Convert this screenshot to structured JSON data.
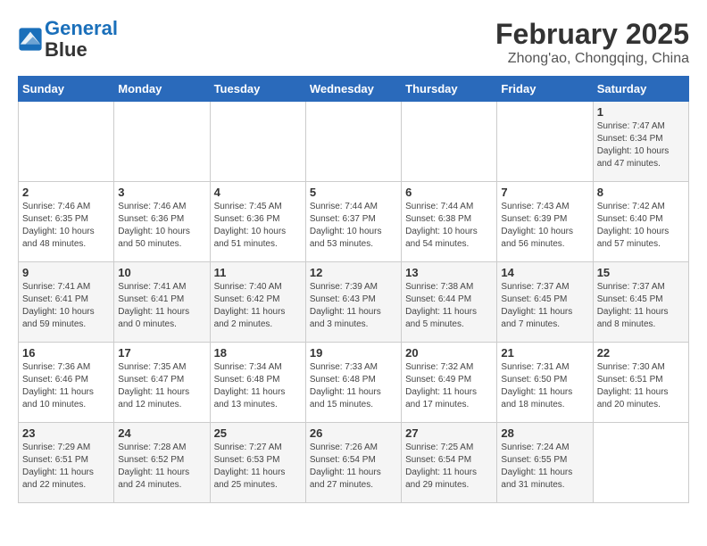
{
  "header": {
    "logo_line1": "General",
    "logo_line2": "Blue",
    "month_title": "February 2025",
    "location": "Zhong'ao, Chongqing, China"
  },
  "weekdays": [
    "Sunday",
    "Monday",
    "Tuesday",
    "Wednesday",
    "Thursday",
    "Friday",
    "Saturday"
  ],
  "weeks": [
    [
      {
        "day": "",
        "info": ""
      },
      {
        "day": "",
        "info": ""
      },
      {
        "day": "",
        "info": ""
      },
      {
        "day": "",
        "info": ""
      },
      {
        "day": "",
        "info": ""
      },
      {
        "day": "",
        "info": ""
      },
      {
        "day": "1",
        "info": "Sunrise: 7:47 AM\nSunset: 6:34 PM\nDaylight: 10 hours and 47 minutes."
      }
    ],
    [
      {
        "day": "2",
        "info": "Sunrise: 7:46 AM\nSunset: 6:35 PM\nDaylight: 10 hours and 48 minutes."
      },
      {
        "day": "3",
        "info": "Sunrise: 7:46 AM\nSunset: 6:36 PM\nDaylight: 10 hours and 50 minutes."
      },
      {
        "day": "4",
        "info": "Sunrise: 7:45 AM\nSunset: 6:36 PM\nDaylight: 10 hours and 51 minutes."
      },
      {
        "day": "5",
        "info": "Sunrise: 7:44 AM\nSunset: 6:37 PM\nDaylight: 10 hours and 53 minutes."
      },
      {
        "day": "6",
        "info": "Sunrise: 7:44 AM\nSunset: 6:38 PM\nDaylight: 10 hours and 54 minutes."
      },
      {
        "day": "7",
        "info": "Sunrise: 7:43 AM\nSunset: 6:39 PM\nDaylight: 10 hours and 56 minutes."
      },
      {
        "day": "8",
        "info": "Sunrise: 7:42 AM\nSunset: 6:40 PM\nDaylight: 10 hours and 57 minutes."
      }
    ],
    [
      {
        "day": "9",
        "info": "Sunrise: 7:41 AM\nSunset: 6:41 PM\nDaylight: 10 hours and 59 minutes."
      },
      {
        "day": "10",
        "info": "Sunrise: 7:41 AM\nSunset: 6:41 PM\nDaylight: 11 hours and 0 minutes."
      },
      {
        "day": "11",
        "info": "Sunrise: 7:40 AM\nSunset: 6:42 PM\nDaylight: 11 hours and 2 minutes."
      },
      {
        "day": "12",
        "info": "Sunrise: 7:39 AM\nSunset: 6:43 PM\nDaylight: 11 hours and 3 minutes."
      },
      {
        "day": "13",
        "info": "Sunrise: 7:38 AM\nSunset: 6:44 PM\nDaylight: 11 hours and 5 minutes."
      },
      {
        "day": "14",
        "info": "Sunrise: 7:37 AM\nSunset: 6:45 PM\nDaylight: 11 hours and 7 minutes."
      },
      {
        "day": "15",
        "info": "Sunrise: 7:37 AM\nSunset: 6:45 PM\nDaylight: 11 hours and 8 minutes."
      }
    ],
    [
      {
        "day": "16",
        "info": "Sunrise: 7:36 AM\nSunset: 6:46 PM\nDaylight: 11 hours and 10 minutes."
      },
      {
        "day": "17",
        "info": "Sunrise: 7:35 AM\nSunset: 6:47 PM\nDaylight: 11 hours and 12 minutes."
      },
      {
        "day": "18",
        "info": "Sunrise: 7:34 AM\nSunset: 6:48 PM\nDaylight: 11 hours and 13 minutes."
      },
      {
        "day": "19",
        "info": "Sunrise: 7:33 AM\nSunset: 6:48 PM\nDaylight: 11 hours and 15 minutes."
      },
      {
        "day": "20",
        "info": "Sunrise: 7:32 AM\nSunset: 6:49 PM\nDaylight: 11 hours and 17 minutes."
      },
      {
        "day": "21",
        "info": "Sunrise: 7:31 AM\nSunset: 6:50 PM\nDaylight: 11 hours and 18 minutes."
      },
      {
        "day": "22",
        "info": "Sunrise: 7:30 AM\nSunset: 6:51 PM\nDaylight: 11 hours and 20 minutes."
      }
    ],
    [
      {
        "day": "23",
        "info": "Sunrise: 7:29 AM\nSunset: 6:51 PM\nDaylight: 11 hours and 22 minutes."
      },
      {
        "day": "24",
        "info": "Sunrise: 7:28 AM\nSunset: 6:52 PM\nDaylight: 11 hours and 24 minutes."
      },
      {
        "day": "25",
        "info": "Sunrise: 7:27 AM\nSunset: 6:53 PM\nDaylight: 11 hours and 25 minutes."
      },
      {
        "day": "26",
        "info": "Sunrise: 7:26 AM\nSunset: 6:54 PM\nDaylight: 11 hours and 27 minutes."
      },
      {
        "day": "27",
        "info": "Sunrise: 7:25 AM\nSunset: 6:54 PM\nDaylight: 11 hours and 29 minutes."
      },
      {
        "day": "28",
        "info": "Sunrise: 7:24 AM\nSunset: 6:55 PM\nDaylight: 11 hours and 31 minutes."
      },
      {
        "day": "",
        "info": ""
      }
    ]
  ]
}
